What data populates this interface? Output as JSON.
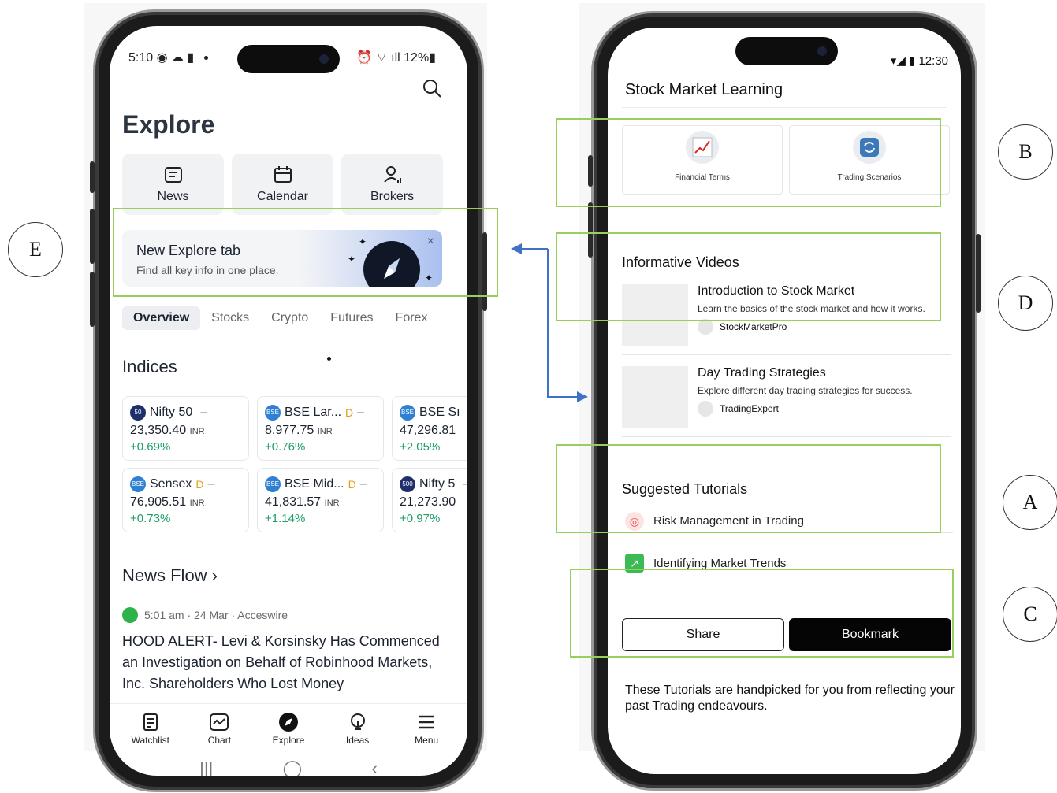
{
  "left_phone": {
    "status_time": "5:10",
    "status_battery": "12%",
    "title": "Explore",
    "quick_tiles": [
      {
        "label": "News",
        "icon": "news-icon"
      },
      {
        "label": "Calendar",
        "icon": "calendar-icon"
      },
      {
        "label": "Brokers",
        "icon": "brokers-icon"
      }
    ],
    "banner": {
      "title": "New Explore tab",
      "subtitle": "Find all key info in one place.",
      "close": "×"
    },
    "tabs": [
      "Overview",
      "Stocks",
      "Crypto",
      "Futures",
      "Forex"
    ],
    "indices_title": "Indices",
    "indices": [
      {
        "badge": "50",
        "badge_color": "#1e2f6b",
        "name": "Nifty 50",
        "d": "",
        "value": "23,350.40",
        "unit": "INR",
        "change": "+0.69%"
      },
      {
        "badge": "BSE",
        "badge_color": "#2f7fd3",
        "name": "BSE Lar...",
        "d": "D",
        "value": "8,977.75",
        "unit": "INR",
        "change": "+0.76%"
      },
      {
        "badge": "BSE",
        "badge_color": "#2f7fd3",
        "name": "BSE Sı",
        "d": "",
        "value": "47,296.81",
        "unit": "",
        "change": "+2.05%"
      },
      {
        "badge": "BSE",
        "badge_color": "#2f7fd3",
        "name": "Sensex",
        "d": "D",
        "value": "76,905.51",
        "unit": "INR",
        "change": "+0.73%"
      },
      {
        "badge": "BSE",
        "badge_color": "#2f7fd3",
        "name": "BSE Mid...",
        "d": "D",
        "value": "41,831.57",
        "unit": "INR",
        "change": "+1.14%"
      },
      {
        "badge": "500",
        "badge_color": "#1e2f6b",
        "name": "Nifty 5",
        "d": "",
        "value": "21,273.90",
        "unit": "",
        "change": "+0.97%"
      }
    ],
    "news_flow_title": "News Flow ›",
    "news": {
      "meta": "5:01 am · 24 Mar · Acceswire",
      "headline": "HOOD ALERT- Levi & Korsinsky Has Commenced an Investigation on Behalf of Robinhood Markets, Inc. Shareholders Who Lost Money"
    },
    "bottom_nav": [
      {
        "label": "Watchlist",
        "icon": "watchlist-icon"
      },
      {
        "label": "Chart",
        "icon": "chart-icon"
      },
      {
        "label": "Explore",
        "icon": "compass-icon"
      },
      {
        "label": "Ideas",
        "icon": "lightbulb-icon"
      },
      {
        "label": "Menu",
        "icon": "menu-icon"
      }
    ],
    "system_nav": [
      "|||",
      "◯",
      "‹"
    ]
  },
  "right_phone": {
    "status_time": "12:30",
    "title": "Stock Market Learning",
    "categories": [
      {
        "label": "Financial Terms",
        "icon": "trend-chart-icon"
      },
      {
        "label": "Trading Scenarios",
        "icon": "refresh-icon"
      }
    ],
    "videos_title": "Informative Videos",
    "videos": [
      {
        "title": "Introduction to Stock Market",
        "desc": "Learn the basics of the stock market and how it works.",
        "channel": "StockMarketPro"
      },
      {
        "title": "Day Trading Strategies",
        "desc": "Explore different day trading strategies for success.",
        "channel": "TradingExpert"
      }
    ],
    "tutorials_title": "Suggested Tutorials",
    "tutorials": [
      {
        "label": "Risk Management in Trading",
        "icon": "target-icon",
        "color": "#e94b4b"
      },
      {
        "label": "Identifying Market Trends",
        "icon": "trend-up-icon",
        "color": "#3cba54"
      }
    ],
    "share_label": "Share",
    "bookmark_label": "Bookmark",
    "footer": "These Tutorials are handpicked for you  from reflecting your past Trading endeavours."
  },
  "callouts": {
    "a": "A",
    "b": "B",
    "c": "C",
    "d": "D",
    "e": "E"
  },
  "colors": {
    "highlight": "#97cf5a",
    "arrow": "#3f72c4",
    "positive": "#1d9e67"
  }
}
